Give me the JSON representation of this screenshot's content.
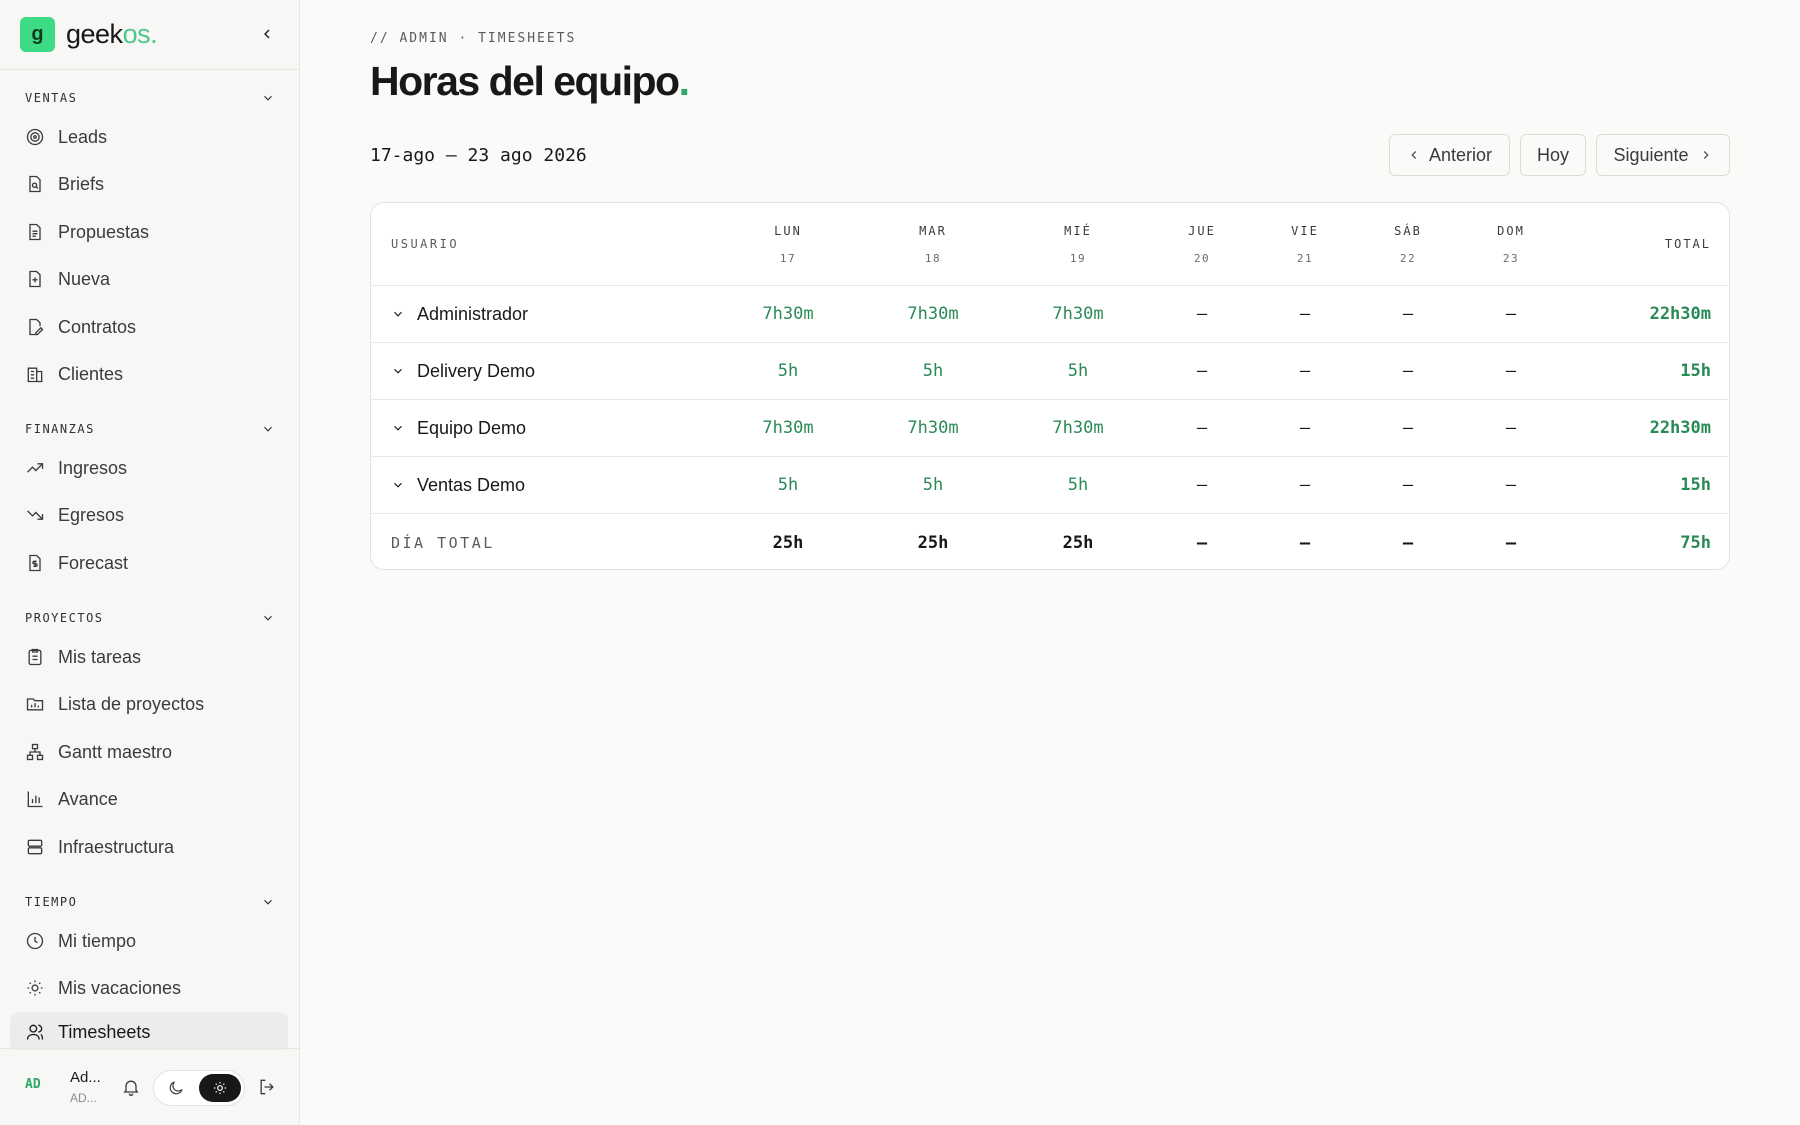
{
  "brand": {
    "name": "geek",
    "suffix": "os."
  },
  "sidebar": {
    "sections": [
      {
        "label": "VENTAS",
        "items": [
          {
            "label": "Leads",
            "icon": "target-icon"
          },
          {
            "label": "Briefs",
            "icon": "file-search-icon"
          },
          {
            "label": "Propuestas",
            "icon": "file-text-icon"
          },
          {
            "label": "Nueva",
            "icon": "file-plus-icon"
          },
          {
            "label": "Contratos",
            "icon": "file-pen-icon"
          },
          {
            "label": "Clientes",
            "icon": "building-icon"
          }
        ]
      },
      {
        "label": "FINANZAS",
        "items": [
          {
            "label": "Ingresos",
            "icon": "trending-up-icon"
          },
          {
            "label": "Egresos",
            "icon": "trending-down-icon"
          },
          {
            "label": "Forecast",
            "icon": "file-dollar-icon"
          }
        ]
      },
      {
        "label": "PROYECTOS",
        "items": [
          {
            "label": "Mis tareas",
            "icon": "clipboard-list-icon"
          },
          {
            "label": "Lista de proyectos",
            "icon": "folder-chart-icon"
          },
          {
            "label": "Gantt maestro",
            "icon": "network-icon"
          },
          {
            "label": "Avance",
            "icon": "bar-chart-icon"
          },
          {
            "label": "Infraestructura",
            "icon": "server-icon"
          }
        ]
      },
      {
        "label": "TIEMPO",
        "items": [
          {
            "label": "Mi tiempo",
            "icon": "clock-icon"
          },
          {
            "label": "Mis vacaciones",
            "icon": "sun-icon"
          },
          {
            "label": "Timesheets",
            "icon": "users-icon",
            "active": true
          }
        ]
      }
    ],
    "footer": {
      "initials": "AD",
      "name": "Ad...",
      "role": "AD..."
    }
  },
  "header": {
    "breadcrumb": "// ADMIN · TIMESHEETS",
    "title": "Horas del equipo",
    "title_dot": ".",
    "range": "17-ago — 23 ago 2026"
  },
  "nav_buttons": {
    "prev": "Anterior",
    "today": "Hoy",
    "next": "Siguiente"
  },
  "table": {
    "user_header": "USUARIO",
    "total_header": "TOTAL",
    "days": [
      {
        "d": "LUN",
        "n": "17"
      },
      {
        "d": "MAR",
        "n": "18"
      },
      {
        "d": "MIÉ",
        "n": "19"
      },
      {
        "d": "JUE",
        "n": "20"
      },
      {
        "d": "VIE",
        "n": "21"
      },
      {
        "d": "SÁB",
        "n": "22"
      },
      {
        "d": "DOM",
        "n": "23"
      }
    ],
    "rows": [
      {
        "name": "Administrador",
        "values": [
          "7h30m",
          "7h30m",
          "7h30m",
          "—",
          "—",
          "—",
          "—"
        ],
        "total": "22h30m"
      },
      {
        "name": "Delivery Demo",
        "values": [
          "5h",
          "5h",
          "5h",
          "—",
          "—",
          "—",
          "—"
        ],
        "total": "15h"
      },
      {
        "name": "Equipo Demo",
        "values": [
          "7h30m",
          "7h30m",
          "7h30m",
          "—",
          "—",
          "—",
          "—"
        ],
        "total": "22h30m"
      },
      {
        "name": "Ventas Demo",
        "values": [
          "5h",
          "5h",
          "5h",
          "—",
          "—",
          "—",
          "—"
        ],
        "total": "15h"
      }
    ],
    "footer": {
      "label": "DÍA TOTAL",
      "values": [
        "25h",
        "25h",
        "25h",
        "—",
        "—",
        "—",
        "—"
      ],
      "total": "75h"
    }
  },
  "colors": {
    "accent": "#2fa96a",
    "logo": "#3ddc84"
  }
}
